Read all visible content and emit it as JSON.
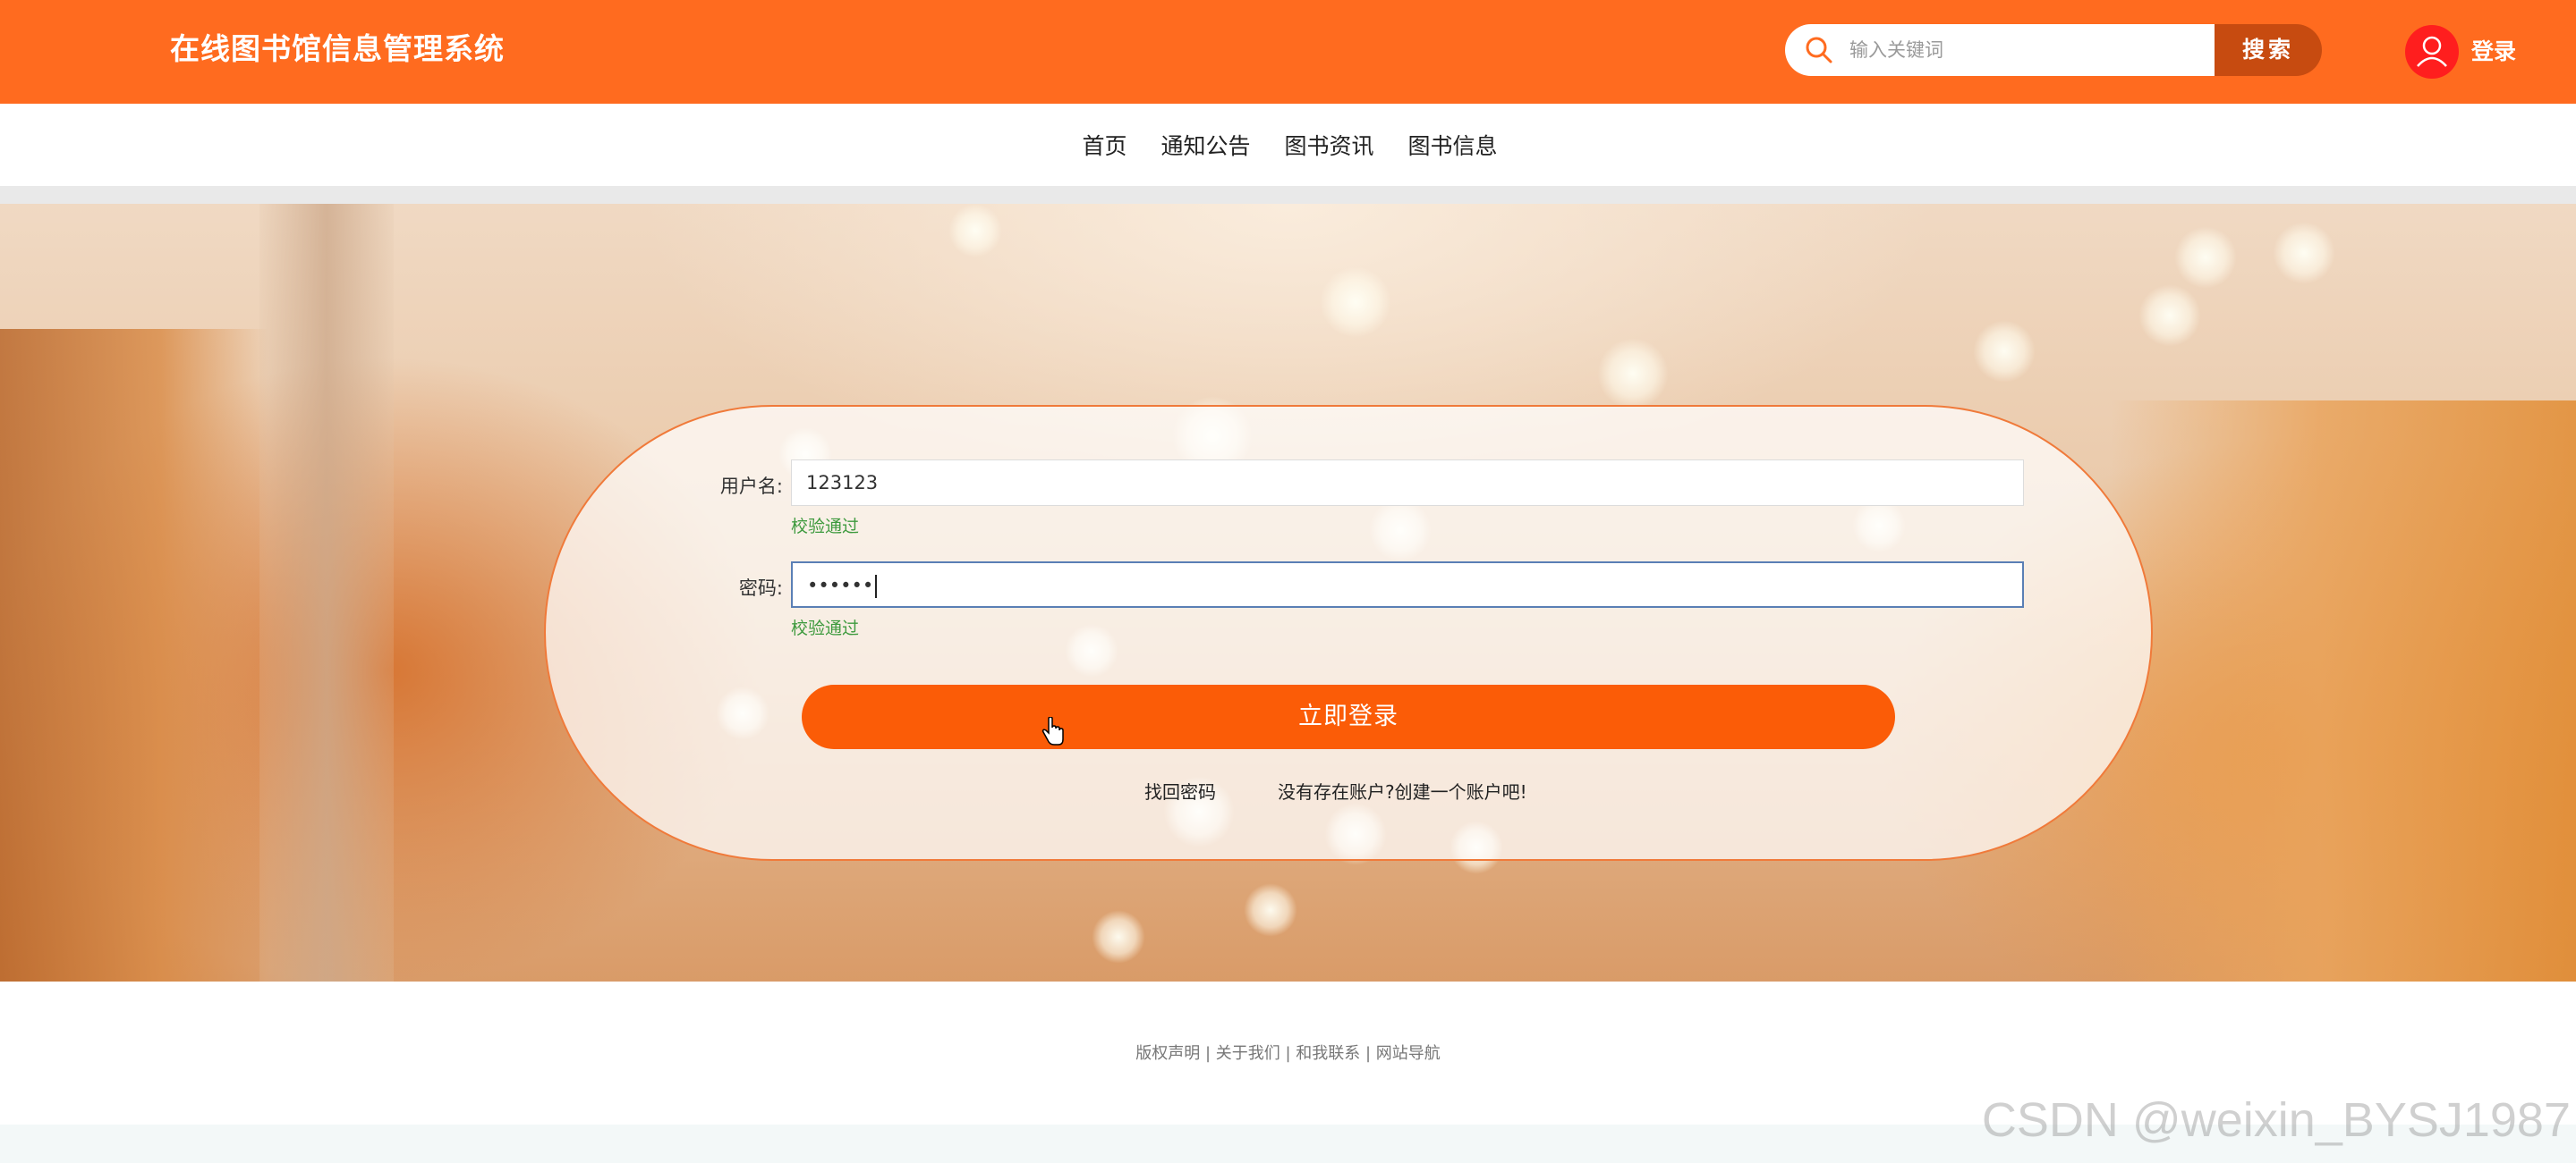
{
  "header": {
    "site_title": "在线图书馆信息管理系统",
    "search_placeholder": "输入关键词",
    "search_button": "搜索",
    "login_label": "登录",
    "brand_color": "#ff6b1f"
  },
  "nav": {
    "items": [
      {
        "label": "首页"
      },
      {
        "label": "通知公告"
      },
      {
        "label": "图书资讯"
      },
      {
        "label": "图书信息"
      }
    ]
  },
  "login_form": {
    "username_label": "用户名:",
    "username_value": "123123",
    "username_validation": "校验通过",
    "password_label": "密码:",
    "password_value": "••••••",
    "password_validation": "校验通过",
    "submit_label": "立即登录",
    "forgot_password": "找回密码",
    "register_prompt": "没有存在账户?创建一个账户吧!",
    "button_color": "#fb5c07",
    "validation_color": "#3e9a3e"
  },
  "footer": {
    "links": [
      "版权声明",
      "关于我们",
      "和我联系",
      "网站导航"
    ],
    "separator": " | "
  },
  "watermark": "CSDN @weixin_BYSJ1987",
  "icons": {
    "search": "search-icon",
    "avatar": "user-icon",
    "cursor": "hand-pointer-icon"
  }
}
